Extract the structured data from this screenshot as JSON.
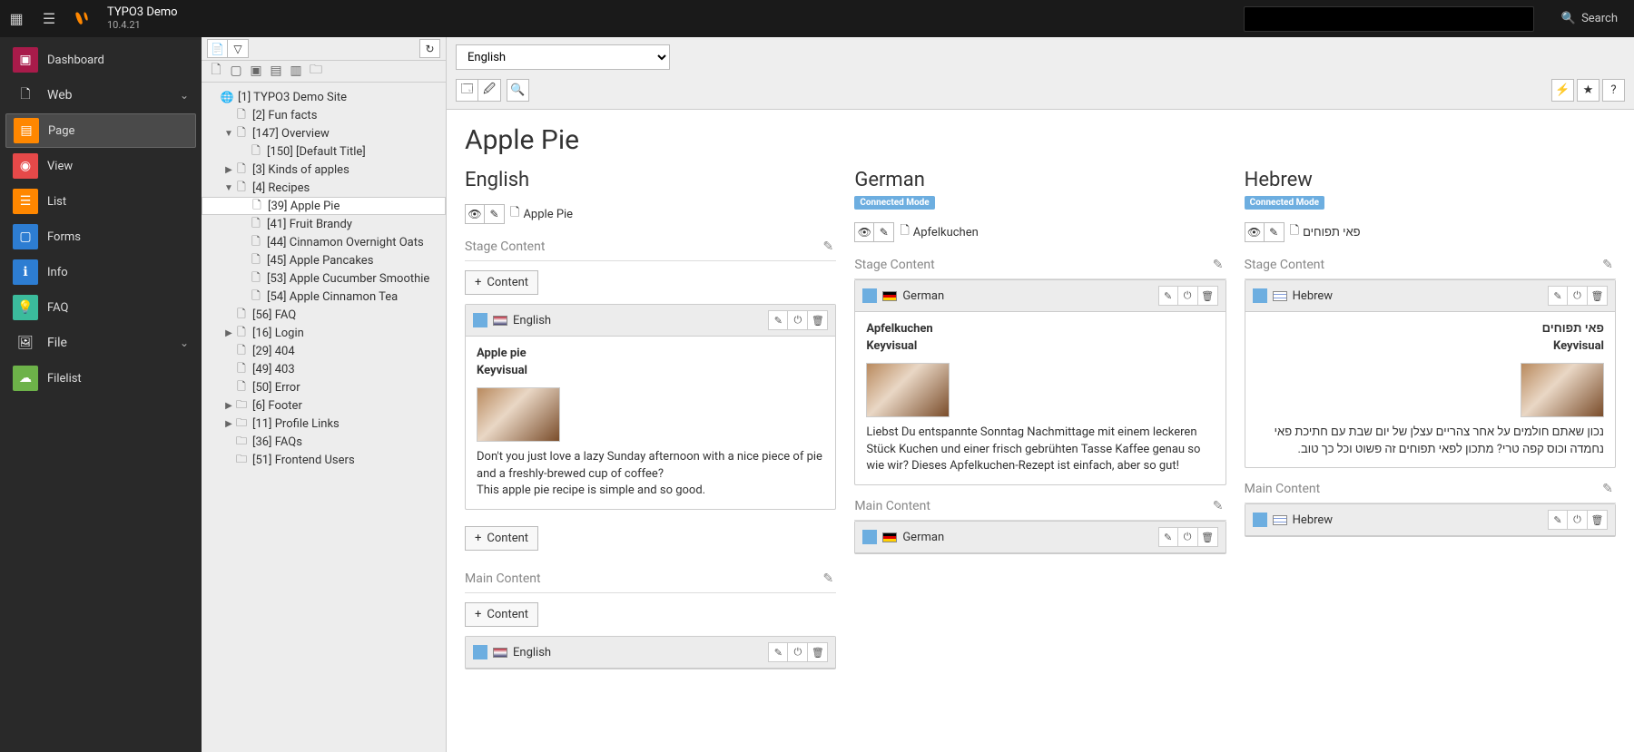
{
  "topbar": {
    "title": "TYPO3 Demo",
    "version": "10.4.21",
    "search_label": "Search"
  },
  "modules": {
    "dashboard": "Dashboard",
    "web": "Web",
    "page": "Page",
    "view": "View",
    "list": "List",
    "forms": "Forms",
    "info": "Info",
    "faq": "FAQ",
    "file": "File",
    "filelist": "Filelist"
  },
  "tree": [
    {
      "indent": 0,
      "toggle": "",
      "icon": "globe",
      "label": "[1] TYPO3 Demo Site"
    },
    {
      "indent": 1,
      "toggle": "",
      "icon": "page",
      "label": "[2] Fun facts"
    },
    {
      "indent": 1,
      "toggle": "▼",
      "icon": "page",
      "label": "[147] Overview"
    },
    {
      "indent": 2,
      "toggle": "",
      "icon": "page",
      "label": "[150] [Default Title]"
    },
    {
      "indent": 1,
      "toggle": "▶",
      "icon": "page",
      "label": "[3] Kinds of apples"
    },
    {
      "indent": 1,
      "toggle": "▼",
      "icon": "page",
      "label": "[4] Recipes"
    },
    {
      "indent": 2,
      "toggle": "",
      "icon": "page",
      "label": "[39] Apple Pie",
      "selected": true
    },
    {
      "indent": 2,
      "toggle": "",
      "icon": "page",
      "label": "[41] Fruit Brandy"
    },
    {
      "indent": 2,
      "toggle": "",
      "icon": "page",
      "label": "[44] Cinnamon Overnight Oats"
    },
    {
      "indent": 2,
      "toggle": "",
      "icon": "page",
      "label": "[45] Apple Pancakes"
    },
    {
      "indent": 2,
      "toggle": "",
      "icon": "page",
      "label": "[53] Apple Cucumber Smoothie"
    },
    {
      "indent": 2,
      "toggle": "",
      "icon": "page",
      "label": "[54] Apple Cinnamon Tea"
    },
    {
      "indent": 1,
      "toggle": "",
      "icon": "page",
      "label": "[56] FAQ"
    },
    {
      "indent": 1,
      "toggle": "▶",
      "icon": "page",
      "label": "[16] Login"
    },
    {
      "indent": 1,
      "toggle": "",
      "icon": "page",
      "label": "[29] 404"
    },
    {
      "indent": 1,
      "toggle": "",
      "icon": "page",
      "label": "[49] 403"
    },
    {
      "indent": 1,
      "toggle": "",
      "icon": "page",
      "label": "[50] Error"
    },
    {
      "indent": 1,
      "toggle": "▶",
      "icon": "folder",
      "label": "[6] Footer"
    },
    {
      "indent": 1,
      "toggle": "▶",
      "icon": "folder",
      "label": "[11] Profile Links"
    },
    {
      "indent": 1,
      "toggle": "",
      "icon": "folder",
      "label": "[36] FAQs"
    },
    {
      "indent": 1,
      "toggle": "",
      "icon": "folder",
      "label": "[51] Frontend Users"
    }
  ],
  "docheader": {
    "language_selected": "English"
  },
  "page": {
    "title": "Apple Pie"
  },
  "columns": [
    {
      "lang": "English",
      "badge": "",
      "page_label": "Apple Pie",
      "flag_colors": "linear-gradient(to bottom,#b22234 0%,#fff 50%,#3c3b6e 100%)",
      "sections": [
        {
          "name": "Stage Content",
          "add_before": true,
          "ce": {
            "flag_label": "English",
            "title": "Apple pie",
            "subtitle": "Keyvisual",
            "text": "Don't you just love a lazy Sunday afternoon with a nice piece of pie and a freshly-brewed cup of coffee?\nThis apple pie recipe is simple and so good."
          },
          "add_after": true
        },
        {
          "name": "Main Content",
          "add_before": true,
          "ce": {
            "flag_label": "English",
            "title": "",
            "subtitle": "",
            "text": ""
          }
        }
      ]
    },
    {
      "lang": "German",
      "badge": "Connected Mode",
      "page_label": "Apfelkuchen",
      "flag_colors": "linear-gradient(to bottom,#000 33%,#dd0000 33%,#dd0000 66%,#ffce00 66%)",
      "sections": [
        {
          "name": "Stage Content",
          "ce": {
            "flag_label": "German",
            "title": "Apfelkuchen",
            "subtitle": "Keyvisual",
            "text": "Liebst Du entspannte Sonntag Nachmittage mit einem leckeren Stück Kuchen und einer frisch gebrühten Tasse Kaffee genau so wie wir? Dieses Apfelkuchen-Rezept ist einfach, aber so gut!"
          }
        },
        {
          "name": "Main Content",
          "ce": {
            "flag_label": "German",
            "title": "",
            "subtitle": "",
            "text": ""
          }
        }
      ]
    },
    {
      "lang": "Hebrew",
      "badge": "Connected Mode",
      "page_label": "פאי תפוחים",
      "flag_colors": "linear-gradient(to bottom,#fff 20%,#0038b8 20%,#0038b8 30%,#fff 30%,#fff 70%,#0038b8 70%,#0038b8 80%,#fff 80%)",
      "rtl": true,
      "sections": [
        {
          "name": "Stage Content",
          "ce": {
            "flag_label": "Hebrew",
            "title": "פאי תפוחים",
            "subtitle": "Keyvisual",
            "text": "נכון שאתם חולמים על אחר צהריים עצלן של יום שבת עם חתיכת פאי נחמדה וכוס קפה טרי? מתכון לפאי תפוחים זה פשוט וכל כך טוב."
          }
        },
        {
          "name": "Main Content",
          "ce": {
            "flag_label": "Hebrew",
            "title": "",
            "subtitle": "",
            "text": ""
          }
        }
      ]
    }
  ],
  "labels": {
    "content_button": "Content"
  }
}
